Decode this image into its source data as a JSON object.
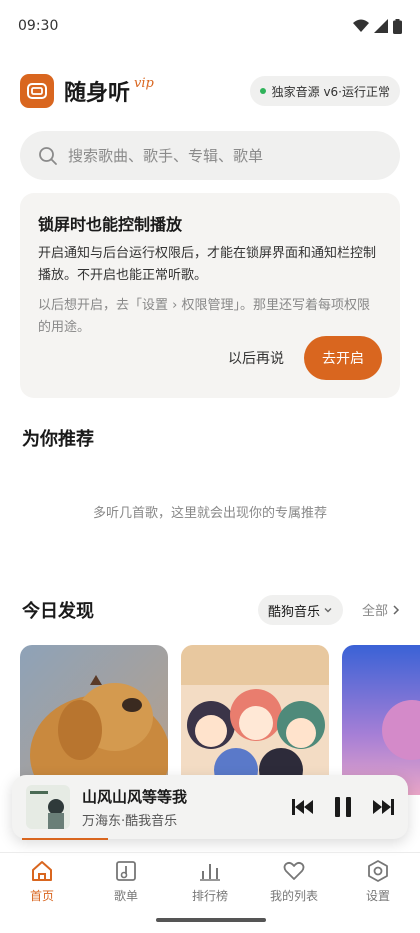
{
  "status": {
    "time": "09:30"
  },
  "header": {
    "title": "随身听",
    "vip": "vip",
    "source_status": "独家音源 v6·运行正常"
  },
  "search": {
    "placeholder": "搜索歌曲、歌手、专辑、歌单"
  },
  "permission_card": {
    "title": "锁屏时也能控制播放",
    "body": "开启通知与后台运行权限后，才能在锁屏界面和通知栏控制播放。不开启也能正常听歌。",
    "note": "以后想开启，去「设置 › 权限管理」。那里还写着每项权限的用途。",
    "later_label": "以后再说",
    "enable_label": "去开启"
  },
  "recommend": {
    "title": "为你推荐",
    "empty_hint": "多听几首歌，这里就会出现你的专属推荐"
  },
  "discover": {
    "title": "今日发现",
    "source": "酷狗音乐",
    "all_label": "全部"
  },
  "now_playing": {
    "title": "山风山风等等我",
    "subtitle": "万海东·酷我音乐",
    "progress": 0.22
  },
  "tabs": [
    {
      "label": "首页",
      "icon": "home-icon",
      "active": true
    },
    {
      "label": "歌单",
      "icon": "playlist-icon",
      "active": false
    },
    {
      "label": "排行榜",
      "icon": "chart-icon",
      "active": false
    },
    {
      "label": "我的列表",
      "icon": "heart-icon",
      "active": false
    },
    {
      "label": "设置",
      "icon": "settings-icon",
      "active": false
    }
  ],
  "colors": {
    "accent": "#d9661f",
    "status_ok": "#2fb35a"
  }
}
